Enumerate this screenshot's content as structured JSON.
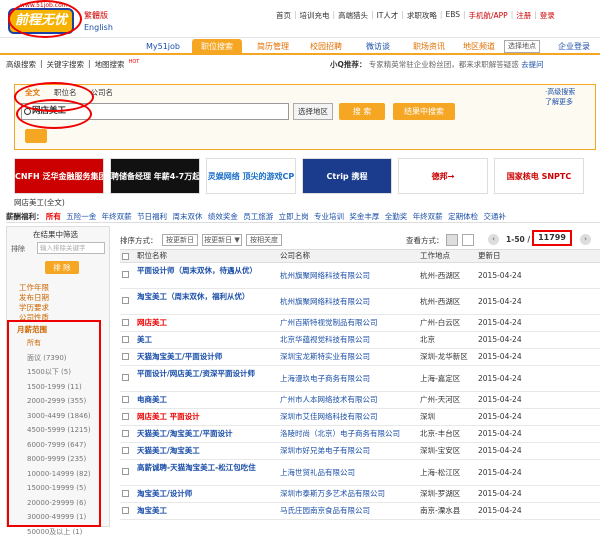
{
  "header": {
    "logo_site": "www.51job.com",
    "logo_text": "前程无忧",
    "lang_traditional": "繁體版",
    "lang_english": "English",
    "top_links": [
      "首页",
      "培训充电",
      "高端猎头",
      "IT人才",
      "求职攻略",
      "EBS",
      "手机航/APP",
      "注册",
      "登录"
    ]
  },
  "nav": [
    "My51job",
    "职位搜索",
    "简历管理",
    "校园招聘",
    "微访谈",
    "职场资讯",
    "地区频道",
    "选择地点",
    "企业登录"
  ],
  "sublinks": {
    "a": "高级搜索",
    "b": "关键字搜索",
    "c": "地图搜索",
    "d": "HOT"
  },
  "qa": {
    "label": "小Q推荐：",
    "text": "专家精英常驻企业粉丝团，都来求职解答疑惑",
    "link": "去提问"
  },
  "search": {
    "tabs": [
      "全文",
      "职位名",
      "公司名"
    ],
    "value": "网店美工",
    "location_btn": "选择地区",
    "search_btn": "搜 索",
    "result_btn": "结果中搜索",
    "right1": "·高级搜索",
    "right2": "了解更多"
  },
  "ads": [
    {
      "text": "CNFH 泛华金融服务集团",
      "color": "#c00",
      "bg": "#fff"
    },
    {
      "text": "聘储备经理 年薪4-7万起",
      "color": "#fff",
      "bg": "#c00"
    },
    {
      "text": "灵娱网络 顶尖的游戏CP",
      "color": "#fff",
      "bg": "#111"
    },
    {
      "text": "Ctrip 携程",
      "color": "#1a6fc8",
      "bg": "#fff"
    },
    {
      "text": "德邦→",
      "color": "#fff",
      "bg": "#1b3c8c"
    },
    {
      "text": "国家核电 SNPTC",
      "color": "#c00",
      "bg": "#fff"
    }
  ],
  "breadcrumb": "网店美工(全文)",
  "filterbar": {
    "label": "薪酬福利：",
    "selected": "所有",
    "items": [
      "五险一金",
      "年终双薪",
      "节日福利",
      "周末双休",
      "绩效奖金",
      "员工旅游",
      "立即上岗",
      "专业培训",
      "奖金丰厚",
      "全勤奖",
      "年终双薪",
      "定期体检",
      "交通补"
    ]
  },
  "leftpanel": {
    "title": "在结果中筛选",
    "exclude_label": "排除",
    "exclude_placeholder": "输入排除关键字",
    "exclude_btn": "排 除",
    "filters": [
      "工作年限",
      "发布日期",
      "学历要求",
      "公司性质"
    ],
    "salary_head": "月薪范围",
    "salary": [
      "所有",
      "面议 (7390)",
      "1500以下 (5)",
      "1500-1999 (11)",
      "2000-2999 (355)",
      "3000-4499 (1846)",
      "4500-5999 (1215)",
      "6000-7999 (647)",
      "8000-9999 (235)",
      "10000-14999 (82)",
      "15000-19999 (5)",
      "20000-29999 (6)",
      "30000-49999 (1)",
      "50000及以上 (1)"
    ]
  },
  "toolbar": {
    "sort_label": "排序方式：",
    "sort_relevance": "按更新日",
    "sort_date": "按更新日 ▼",
    "sort_salary": "按相关度",
    "view_label": "查看方式：",
    "page": "1-50 /",
    "total": "11799"
  },
  "listhead": {
    "job": "职位名称",
    "company": "公司名称",
    "location": "工作地点",
    "date": "更新日"
  },
  "rows": [
    {
      "job": "平面设计师（周末双休，待遇从优）",
      "company": "杭州旗聚网络科技有限公司",
      "location": "杭州-西湖区",
      "date": "2015-04-24"
    },
    {
      "job": "淘宝美工（周末双休，福利从优）",
      "company": "杭州旗聚网络科技有限公司",
      "location": "杭州-西湖区",
      "date": "2015-04-24"
    },
    {
      "job": "网店美工",
      "company": "广州百斯特视觉制品有限公司",
      "location": "广州-白云区",
      "date": "2015-04-24"
    },
    {
      "job": "美工",
      "company": "北京华蕴视觉科技有限公司",
      "location": "北京",
      "date": "2015-04-24"
    },
    {
      "job": "天猫淘宝美工/平面设计师",
      "company": "深圳宝龙斯特实业有限公司",
      "location": "深圳-龙华新区",
      "date": "2015-04-24"
    },
    {
      "job": "平面设计/网店美工/资深平面设计师",
      "company": "上海漫玖电子商务有限公司",
      "location": "上海-嘉定区",
      "date": "2015-04-24"
    },
    {
      "job": "电商美工",
      "company": "广州市人本网络技术有限公司",
      "location": "广州-天河区",
      "date": "2015-04-24"
    },
    {
      "job": "网店美工 平面设计",
      "company": "深圳市艾佳网络科技有限公司",
      "location": "深圳",
      "date": "2015-04-24"
    },
    {
      "job": "天猫美工/淘宝美工/平面设计",
      "company": "洛陵时尚（北京）电子商务有限公司",
      "location": "北京-丰台区",
      "date": "2015-04-24"
    },
    {
      "job": "天猫美工/淘宝美工",
      "company": "深圳市好兄弟电子有限公司",
      "location": "深圳-宝安区",
      "date": "2015-04-24"
    },
    {
      "job": "高薪诚聘-天猫淘宝美工-松江包吃住",
      "company": "上海世贸礼品有限公司",
      "location": "上海-松江区",
      "date": "2015-04-24"
    },
    {
      "job": "淘宝美工/设计师",
      "company": "深圳市泰斯万多艺术品有限公司",
      "location": "深圳-罗湖区",
      "date": "2015-04-24"
    },
    {
      "job": "淘宝美工",
      "company": "马氏庄园南京食品有限公司",
      "location": "南京-溧水县",
      "date": "2015-04-24"
    }
  ]
}
